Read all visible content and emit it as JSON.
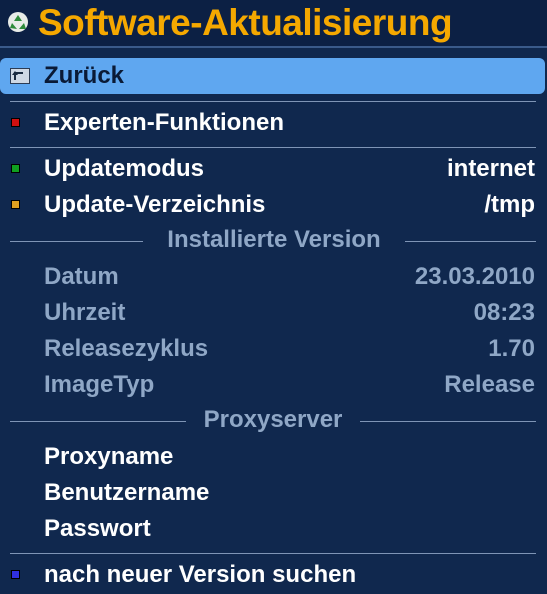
{
  "header": {
    "title": "Software-Aktualisierung",
    "icon": "recycle-icon"
  },
  "menu": {
    "back": {
      "label": "Zurück",
      "icon": "back-arrow-icon"
    },
    "expert": {
      "label": "Experten-Funktionen",
      "key_color": "#d01010"
    },
    "mode": {
      "label": "Updatemodus",
      "value": "internet",
      "key_color": "#10a020"
    },
    "directory": {
      "label": "Update-Verzeichnis",
      "value": "/tmp",
      "key_color": "#e0a020"
    },
    "installed_section": "Installierte Version",
    "date": {
      "label": "Datum",
      "value": "23.03.2010"
    },
    "time": {
      "label": "Uhrzeit",
      "value": "08:23"
    },
    "release_cycle": {
      "label": "Releasezyklus",
      "value": "1.70"
    },
    "image_type": {
      "label": "ImageTyp",
      "value": "Release"
    },
    "proxy_section": "Proxyserver",
    "proxy_name": {
      "label": "Proxyname"
    },
    "username": {
      "label": "Benutzername"
    },
    "password": {
      "label": "Passwort"
    },
    "search": {
      "label": "nach neuer Version suchen",
      "key_color": "#3030e0"
    }
  },
  "colors": {
    "title": "#f5a800",
    "background": "#10284e",
    "selection": "#5fa7f0",
    "disabled_text": "#8fa7c6"
  }
}
